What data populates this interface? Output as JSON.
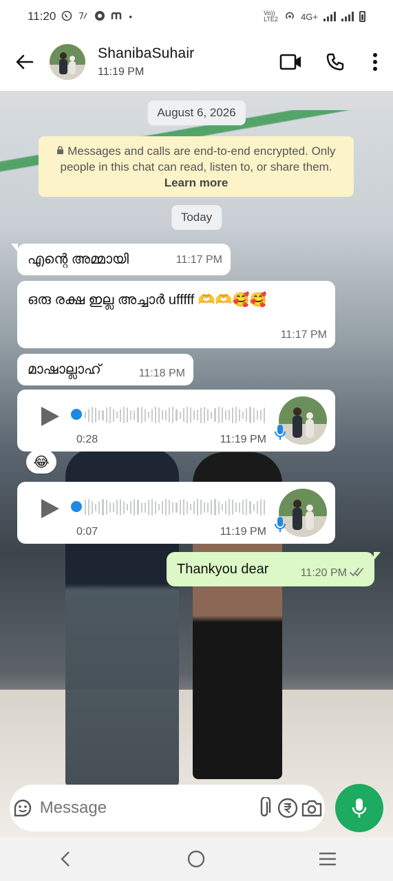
{
  "status_bar": {
    "time": "11:20",
    "left_icons": [
      "whatsapp-icon",
      "alarm-icon",
      "camera-app-icon",
      "m-app-icon",
      "dot-icon"
    ],
    "volte": "Vo)) LTE2",
    "network": "4G+"
  },
  "header": {
    "contact_name": "ShanibaSuhair",
    "contact_status": "11:19 PM"
  },
  "chat": {
    "date_chip": "August 6, 2026",
    "encryption_notice": "Messages and calls are end-to-end encrypted. Only people in this chat can read, listen to, or share them.",
    "encryption_link": "Learn more",
    "today_chip": "Today",
    "messages": [
      {
        "type": "text",
        "direction": "incoming",
        "text": "എന്റെ അമ്മായി",
        "time": "11:17 PM"
      },
      {
        "type": "text",
        "direction": "incoming",
        "text": "ഒരു രക്ഷ ഇല്ല അച്ചാർ ufffff 🫶🫶🥰🥰",
        "time": "11:17 PM"
      },
      {
        "type": "text",
        "direction": "incoming",
        "text": "മാഷാല്ലാഹ്",
        "time": "11:18 PM"
      },
      {
        "type": "voice",
        "direction": "incoming",
        "duration": "0:28",
        "time": "11:19 PM",
        "reaction": "😂"
      },
      {
        "type": "voice",
        "direction": "incoming",
        "duration": "0:07",
        "time": "11:19 PM"
      },
      {
        "type": "text",
        "direction": "outgoing",
        "text": "Thankyou dear",
        "time": "11:20 PM",
        "status": "read"
      }
    ]
  },
  "input": {
    "placeholder": "Message"
  },
  "colors": {
    "accent_green": "#1daa61",
    "outgoing_bubble": "#dcf8c6",
    "notice_bg": "#fdf3c8",
    "voice_dot": "#1e88e5"
  }
}
